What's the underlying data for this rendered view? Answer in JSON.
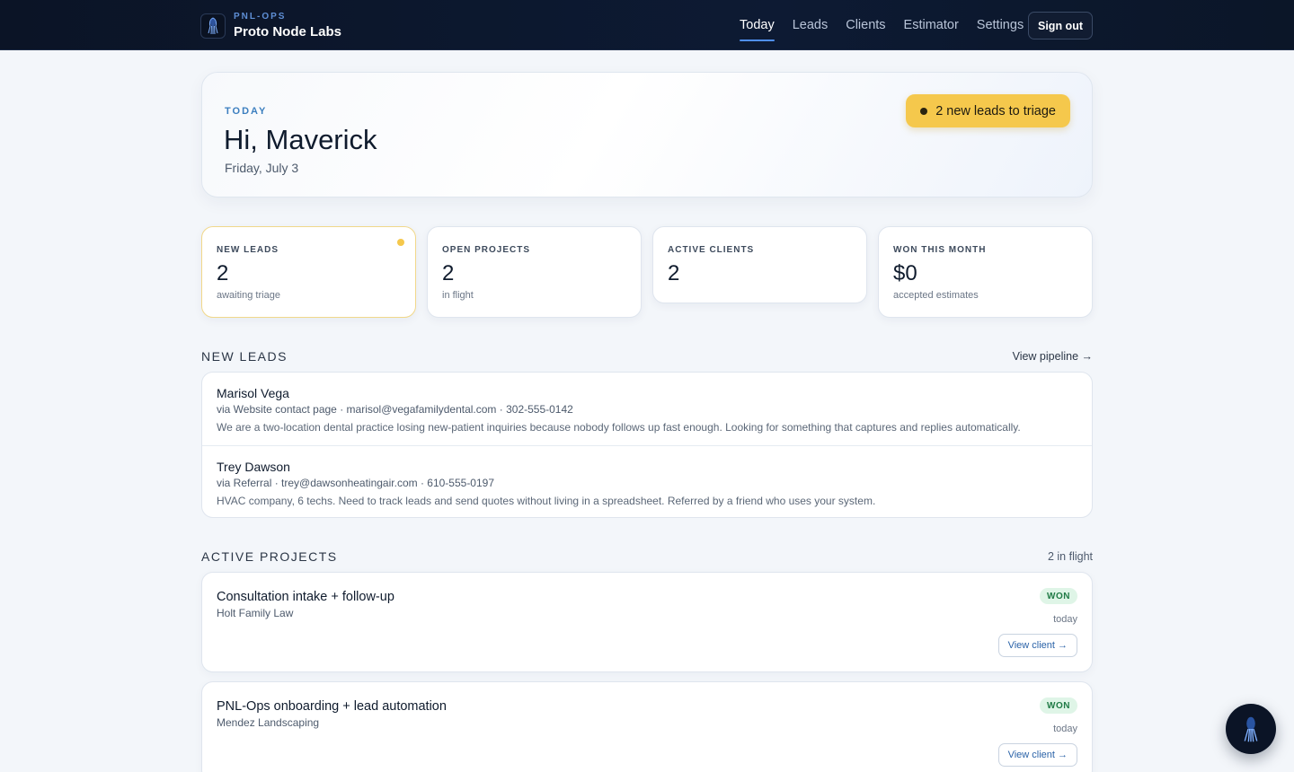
{
  "brand": {
    "tag": "PNL-OPS",
    "name": "Proto Node Labs",
    "logo_icon": "squid-logo-icon"
  },
  "nav": {
    "items": [
      {
        "label": "Today",
        "active": true
      },
      {
        "label": "Leads",
        "active": false
      },
      {
        "label": "Clients",
        "active": false
      },
      {
        "label": "Estimator",
        "active": false
      },
      {
        "label": "Settings",
        "active": false
      }
    ],
    "signout_label": "Sign out"
  },
  "hero": {
    "kicker": "TODAY",
    "greeting": "Hi, Maverick",
    "date": "Friday, July 3",
    "triage_label": "2 new leads to triage"
  },
  "stats": [
    {
      "label": "NEW LEADS",
      "value": "2",
      "sub": "awaiting triage"
    },
    {
      "label": "OPEN PROJECTS",
      "value": "2",
      "sub": "in flight"
    },
    {
      "label": "ACTIVE CLIENTS",
      "value": "2",
      "sub": ""
    },
    {
      "label": "WON THIS MONTH",
      "value": "$0",
      "sub": "accepted estimates"
    }
  ],
  "new_leads": {
    "title": "NEW LEADS",
    "link": "View pipeline →",
    "items": [
      {
        "name": "Marisol Vega",
        "meta": "via Website contact page · marisol@vegafamilydental.com · 302-555-0142",
        "note": "We are a two-location dental practice losing new-patient inquiries because nobody follows up fast enough. Looking for something that captures and replies automatically."
      },
      {
        "name": "Trey Dawson",
        "meta": "via Referral · trey@dawsonheatingair.com · 610-555-0197",
        "note": "HVAC company, 6 techs. Need to track leads and send quotes without living in a spreadsheet. Referred by a friend who uses your system."
      }
    ]
  },
  "active_projects": {
    "title": "ACTIVE PROJECTS",
    "meta": "2 in flight",
    "items": [
      {
        "title": "Consultation intake + follow-up",
        "client": "Holt Family Law",
        "status": "WON",
        "when": "today",
        "action": "View client →"
      },
      {
        "title": "PNL-Ops onboarding + lead automation",
        "client": "Mendez Landscaping",
        "status": "WON",
        "when": "today",
        "action": "View client →"
      }
    ]
  },
  "colors": {
    "accent": "#f5c84c",
    "nav_bg": "#0b1426",
    "won_badge": "#dff5e7",
    "link": "#2b63a8"
  },
  "assistant": {
    "icon": "squid-assistant-icon"
  }
}
